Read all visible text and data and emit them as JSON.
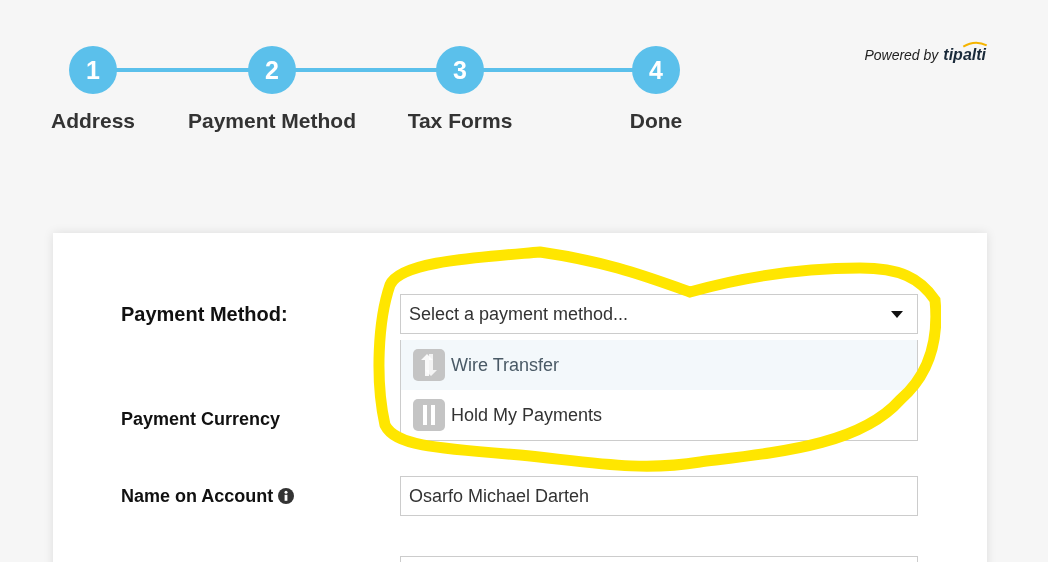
{
  "steps": [
    {
      "number": "1",
      "label": "Address"
    },
    {
      "number": "2",
      "label": "Payment Method"
    },
    {
      "number": "3",
      "label": "Tax Forms"
    },
    {
      "number": "4",
      "label": "Done"
    }
  ],
  "powered_by": {
    "text": "Powered by",
    "brand": "tipalti"
  },
  "form": {
    "payment_method": {
      "label": "Payment Method:",
      "placeholder": "Select a payment method...",
      "expanded": true,
      "options": [
        {
          "label": "Wire Transfer",
          "kind": "wire",
          "selected": true
        },
        {
          "label": "Hold My Payments",
          "kind": "hold",
          "selected": false
        }
      ]
    },
    "payment_currency": {
      "label": "Payment Currency"
    },
    "name_on_account": {
      "label": "Name on Account",
      "value": "Osarfo Michael Darteh"
    }
  }
}
